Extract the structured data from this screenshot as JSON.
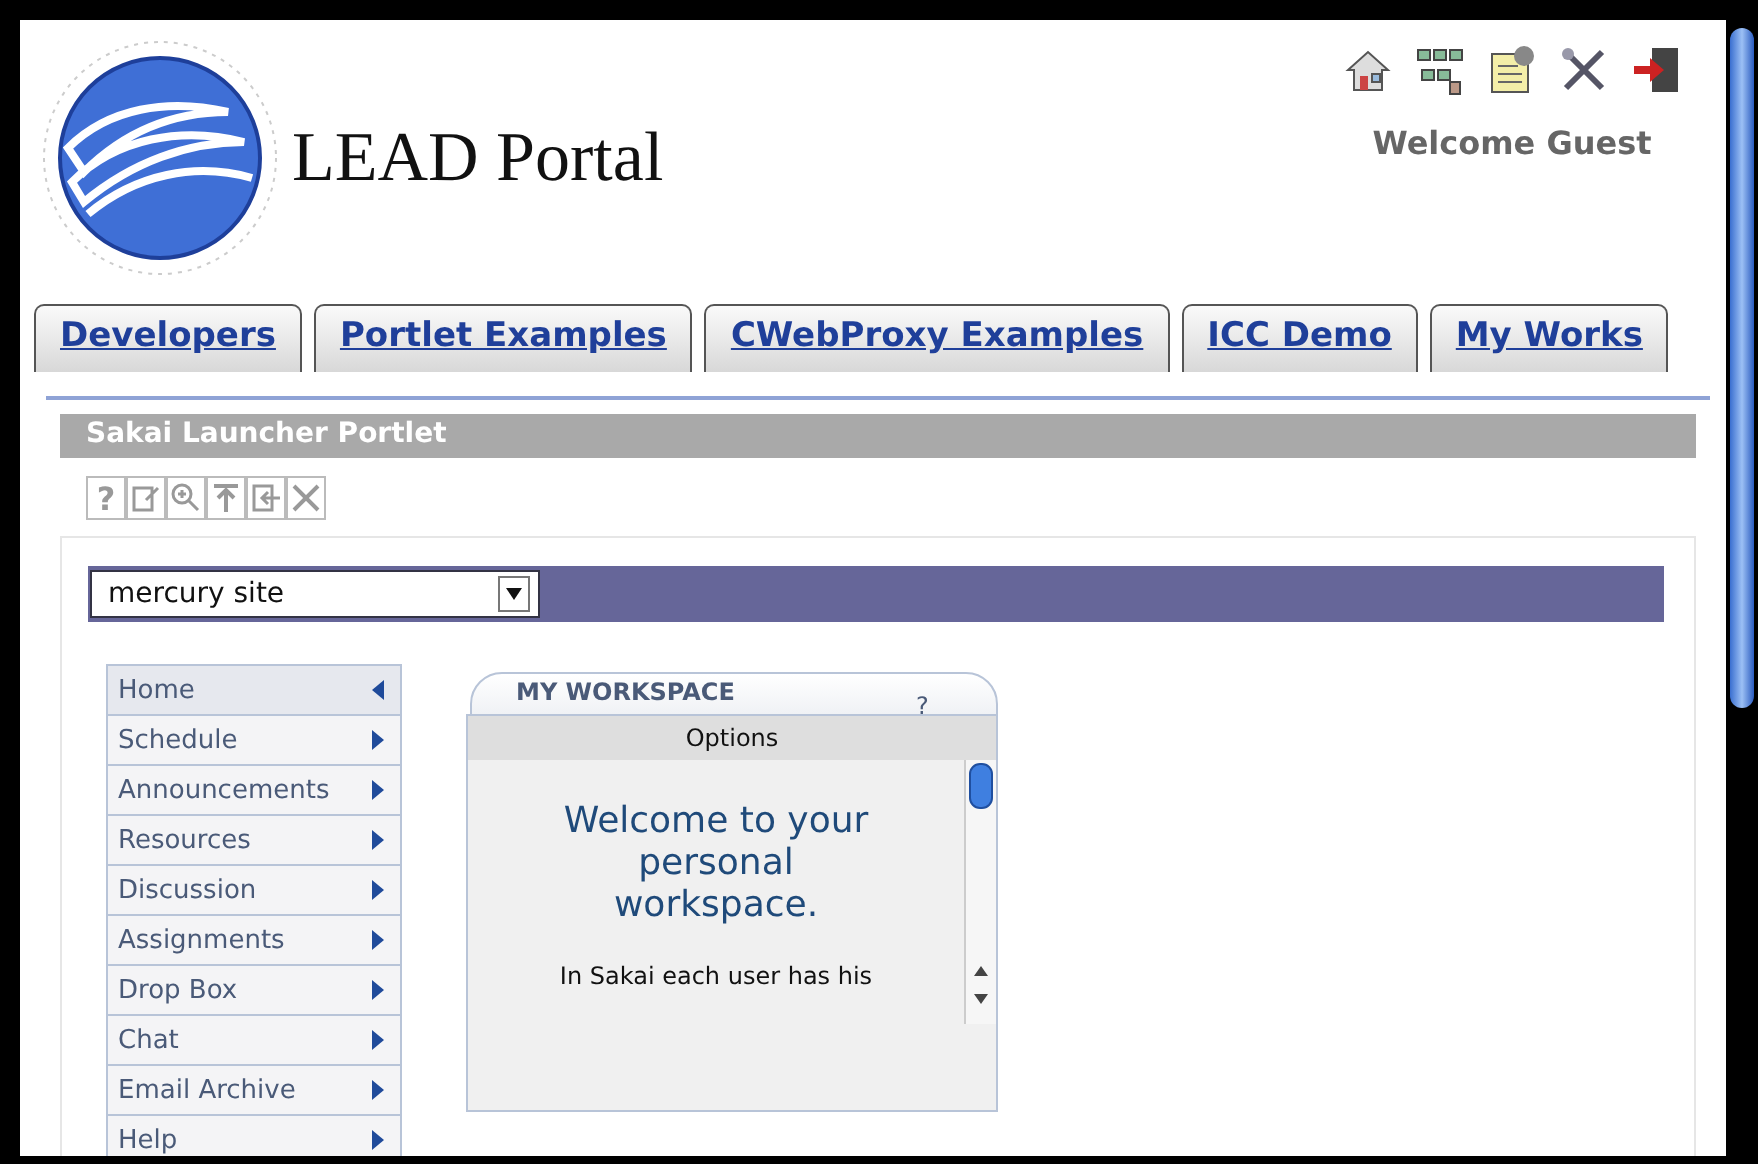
{
  "header": {
    "title": "LEAD Portal",
    "welcome": "Welcome Guest"
  },
  "tabs": [
    {
      "label": "Developers",
      "selected": false
    },
    {
      "label": "Portlet Examples",
      "selected": false
    },
    {
      "label": "CWebProxy Examples",
      "selected": false
    },
    {
      "label": "ICC Demo",
      "selected": false
    },
    {
      "label": "My Works",
      "selected": false
    }
  ],
  "portlet": {
    "title": "Sakai Launcher Portlet",
    "toolbar": [
      "?"
    ],
    "site_select": {
      "value": "mercury site"
    }
  },
  "menu": [
    {
      "label": "Home",
      "selected": true
    },
    {
      "label": "Schedule",
      "selected": false
    },
    {
      "label": "Announcements",
      "selected": false
    },
    {
      "label": "Resources",
      "selected": false
    },
    {
      "label": "Discussion",
      "selected": false
    },
    {
      "label": "Assignments",
      "selected": false
    },
    {
      "label": "Drop Box",
      "selected": false
    },
    {
      "label": "Chat",
      "selected": false
    },
    {
      "label": "Email Archive",
      "selected": false
    },
    {
      "label": "Help",
      "selected": false
    }
  ],
  "workspace": {
    "title": "MY WORKSPACE",
    "help": "?",
    "options": "Options",
    "heading": "Welcome to your personal workspace.",
    "body": "In Sakai each user has his"
  }
}
